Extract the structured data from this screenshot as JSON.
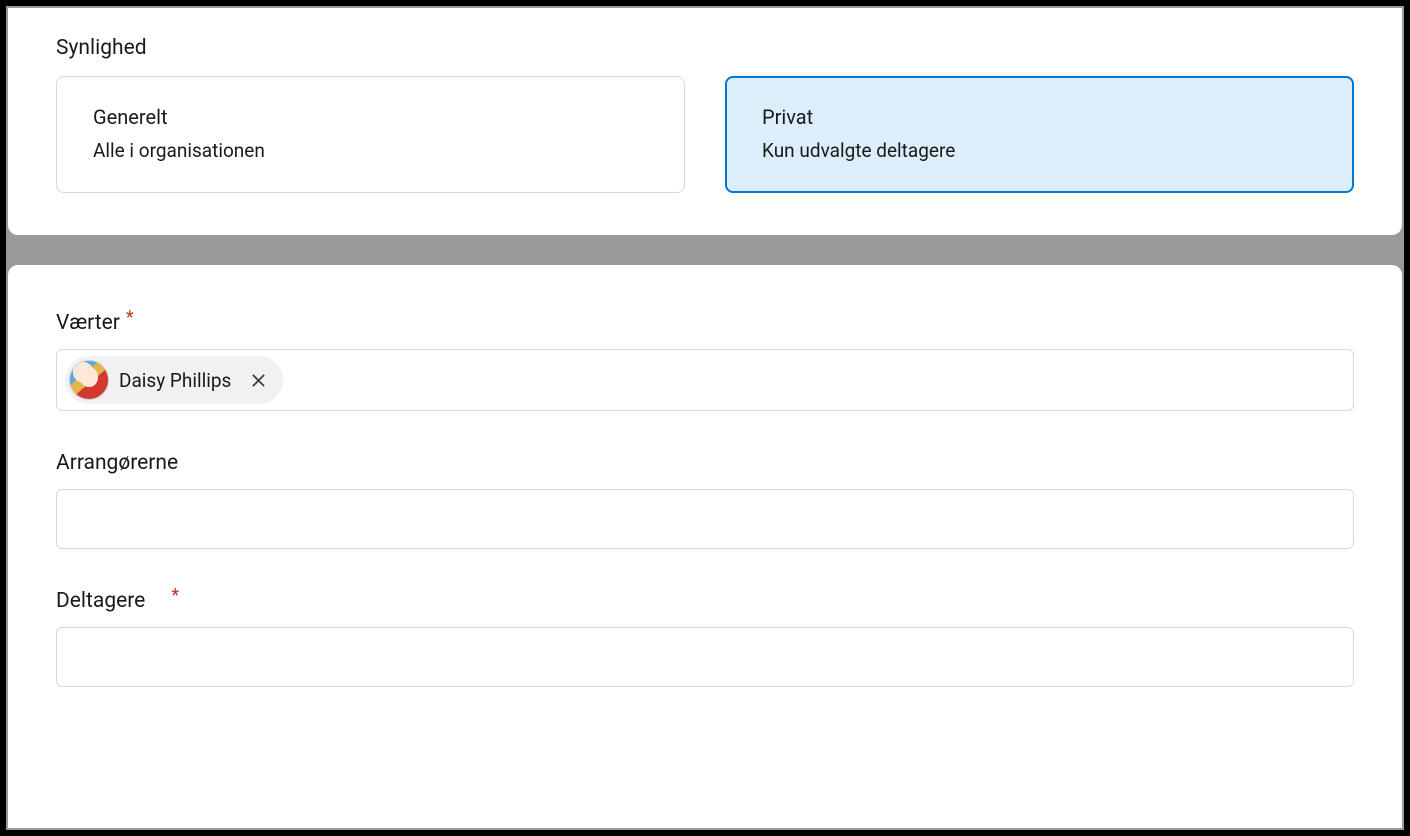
{
  "visibility": {
    "heading": "Synlighed",
    "options": {
      "general": {
        "title": "Generelt",
        "desc": "Alle i organisationen"
      },
      "private": {
        "title": "Privat",
        "desc": "Kun udvalgte deltagere"
      }
    },
    "selected": "private"
  },
  "people": {
    "hosts": {
      "label": "Værter",
      "required_mark": "*",
      "chips": [
        {
          "name": "Daisy Phillips"
        }
      ]
    },
    "organizers": {
      "label": "Arrangørerne"
    },
    "participants": {
      "label": "Deltagere",
      "required_mark": "*"
    }
  }
}
